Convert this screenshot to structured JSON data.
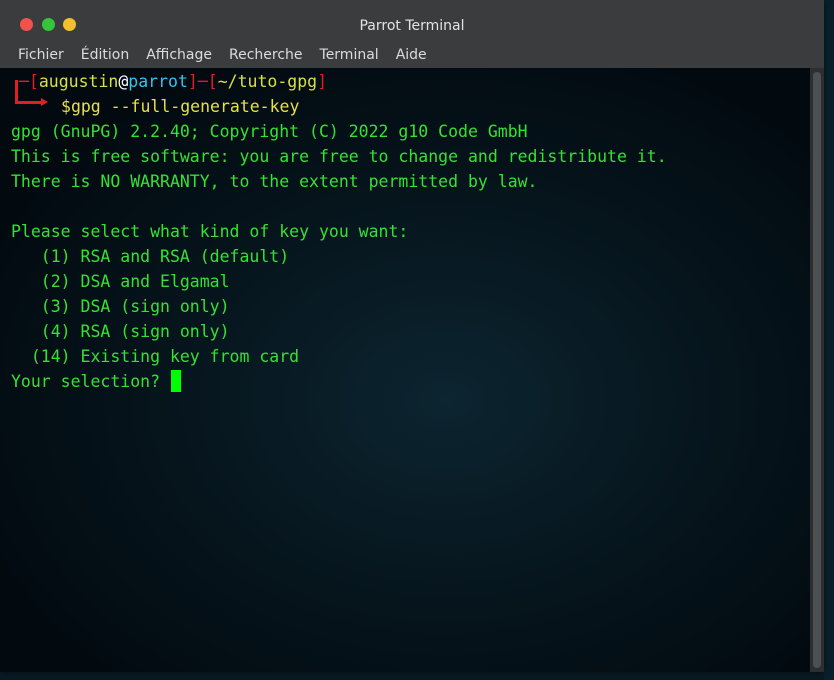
{
  "window": {
    "title": "Parrot Terminal"
  },
  "menu": {
    "items": [
      "Fichier",
      "Édition",
      "Affichage",
      "Recherche",
      "Terminal",
      "Aide"
    ]
  },
  "prompt": {
    "open_bracket": "[",
    "user": "augustin",
    "at": "@",
    "host": "parrot",
    "close_bracket": "]",
    "dash": "─",
    "path_open": "[",
    "path": "~/tuto-gpg",
    "path_close": "]",
    "dollar": "$",
    "command": "gpg --full-generate-key"
  },
  "output": {
    "lines": [
      "gpg (GnuPG) 2.2.40; Copyright (C) 2022 g10 Code GmbH",
      "This is free software: you are free to change and redistribute it.",
      "There is NO WARRANTY, to the extent permitted by law.",
      "",
      "Please select what kind of key you want:",
      "   (1) RSA and RSA (default)",
      "   (2) DSA and Elgamal",
      "   (3) DSA (sign only)",
      "   (4) RSA (sign only)",
      "  (14) Existing key from card"
    ],
    "input_prompt": "Your selection? "
  }
}
